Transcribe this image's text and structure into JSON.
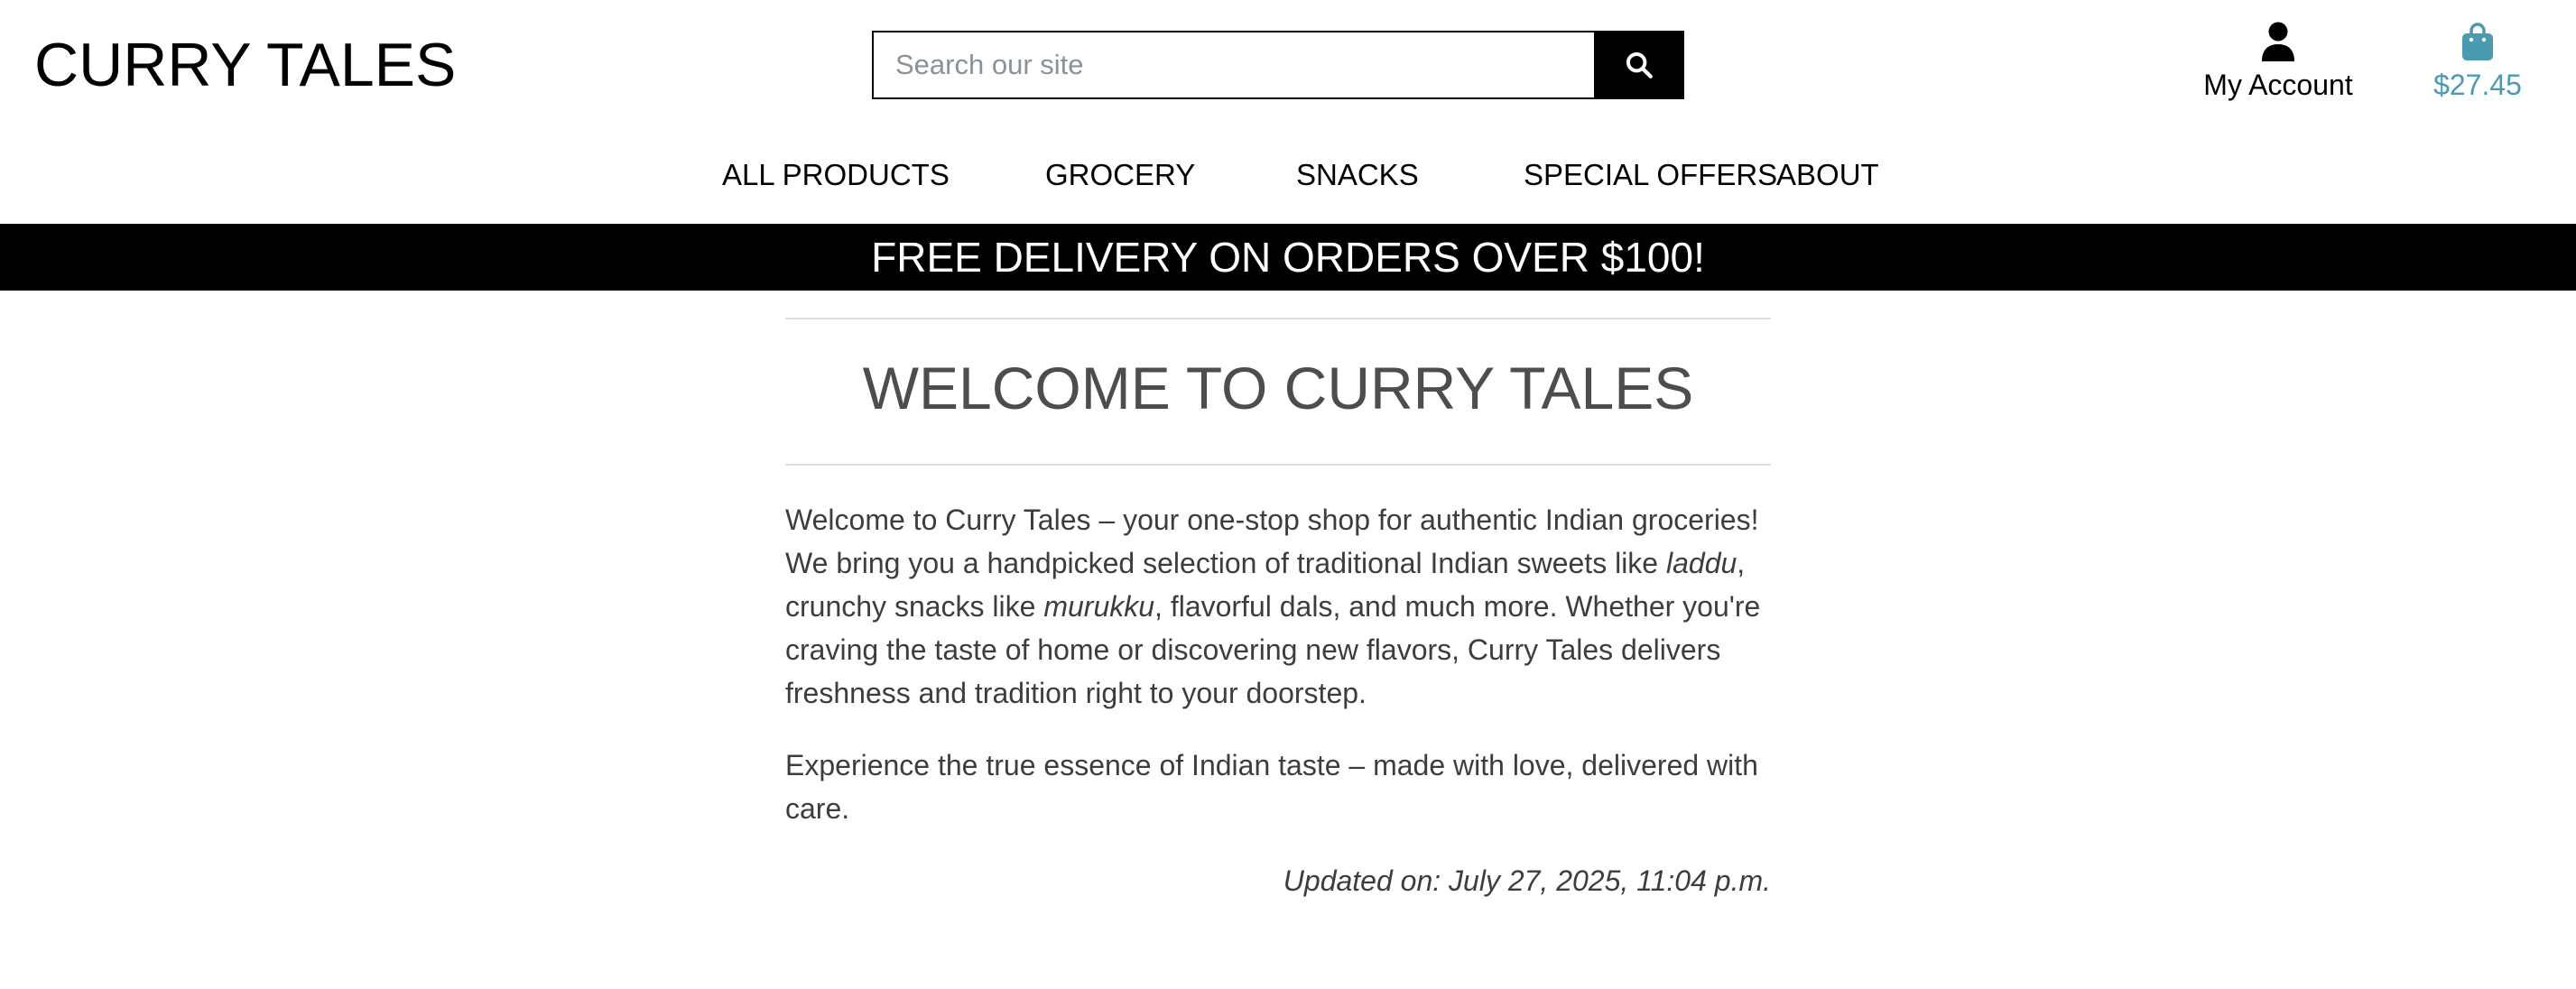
{
  "header": {
    "logo": "CURRY TALES",
    "search": {
      "placeholder": "Search our site",
      "value": ""
    },
    "account_label": "My Account",
    "bag_total": "$27.45"
  },
  "nav": {
    "items": [
      {
        "label": "ALL PRODUCTS"
      },
      {
        "label": "GROCERY"
      },
      {
        "label": "SNACKS"
      },
      {
        "label": "SPECIAL OFFERS"
      },
      {
        "label": "ABOUT"
      }
    ]
  },
  "banner": {
    "text": "FREE DELIVERY ON ORDERS OVER $100!"
  },
  "main": {
    "title": "WELCOME TO CURRY TALES",
    "paragraph1": {
      "part1": "Welcome to Curry Tales – your one-stop shop for authentic Indian groceries! We bring you a handpicked selection of traditional Indian sweets like ",
      "em1": "laddu",
      "part2": ", crunchy snacks like ",
      "em2": "murukku",
      "part3": ", flavorful dals, and much more. Whether you're craving the taste of home or discovering new flavors, Curry Tales delivers freshness and tradition right to your doorstep."
    },
    "paragraph2": "Experience the true essence of Indian taste – made with love, delivered with care.",
    "updated": "Updated on: July 27, 2025, 11:04 p.m."
  },
  "colors": {
    "accent": "#4a9bb0",
    "banner_bg": "#000000",
    "banner_text": "#ffffff",
    "title_text": "#4d4d4d",
    "body_text": "#3d3d3d"
  },
  "icons": {
    "search": "search-icon",
    "account": "user-icon",
    "bag": "shopping-bag-icon"
  }
}
